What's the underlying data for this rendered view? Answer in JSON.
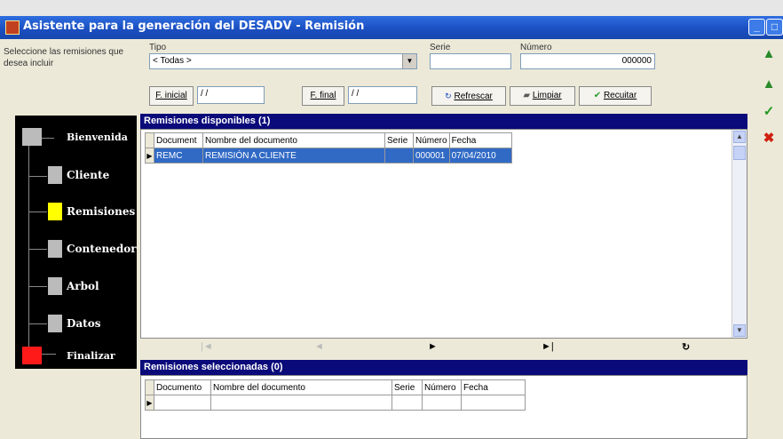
{
  "window": {
    "title": "Asistente para la generación del DESADV - Remisión",
    "app_icon": "app-icon",
    "minimize_icon": "minimize-icon",
    "maximize_icon": "maximize-icon",
    "close_icon": "close-icon"
  },
  "instructions": "Seleccione las remisiones que desea incluir",
  "filters": {
    "tipo_label": "Tipo",
    "tipo_value": "< Todas >",
    "serie_label": "Serie",
    "serie_value": "",
    "numero_label": "Número",
    "numero_value": "000000",
    "finicial_label": "F. inicial",
    "finicial_value": "/ /",
    "ffinal_label": "F. final",
    "ffinal_value": "/ /"
  },
  "buttons": {
    "refrescar": "Refrescar",
    "limpiar": "Limpiar",
    "recuitar": "Recuitar"
  },
  "wizard_steps": [
    {
      "label": "Bienvenida",
      "state": "done"
    },
    {
      "label": "Cliente",
      "state": "done"
    },
    {
      "label": "Remisiones",
      "state": "current"
    },
    {
      "label": "Contenedor",
      "state": "pending"
    },
    {
      "label": "Arbol",
      "state": "pending"
    },
    {
      "label": "Datos",
      "state": "pending"
    },
    {
      "label": "Finalizar",
      "state": "end"
    }
  ],
  "available": {
    "header": "Remisiones disponibles (1)",
    "columns": [
      "Document",
      "Nombre del documento",
      "Serie",
      "Número",
      "Fecha"
    ],
    "rows": [
      {
        "documento": "REMC",
        "nombre": "REMISIÓN A CLIENTE",
        "serie": "",
        "numero": "000001",
        "fecha": "07/04/2010"
      }
    ]
  },
  "record_nav": {
    "first": "|◄",
    "prev": "◄",
    "next": "►",
    "last": "►|",
    "refresh": "↻"
  },
  "selected": {
    "header": "Remisiones seleccionadas (0)",
    "columns": [
      "Documento",
      "Nombre del documento",
      "Serie",
      "Número",
      "Fecha"
    ],
    "rows": []
  },
  "side_toolbar": {
    "up_top": "▲",
    "up": "▲",
    "accept": "✓",
    "cancel": "✖"
  },
  "colors": {
    "titlebar": "#1b4fc2",
    "grid_header": "#0a0a7a",
    "selection": "#316ac5",
    "current_step": "#ffff00",
    "end_step": "#ff1a1a"
  }
}
